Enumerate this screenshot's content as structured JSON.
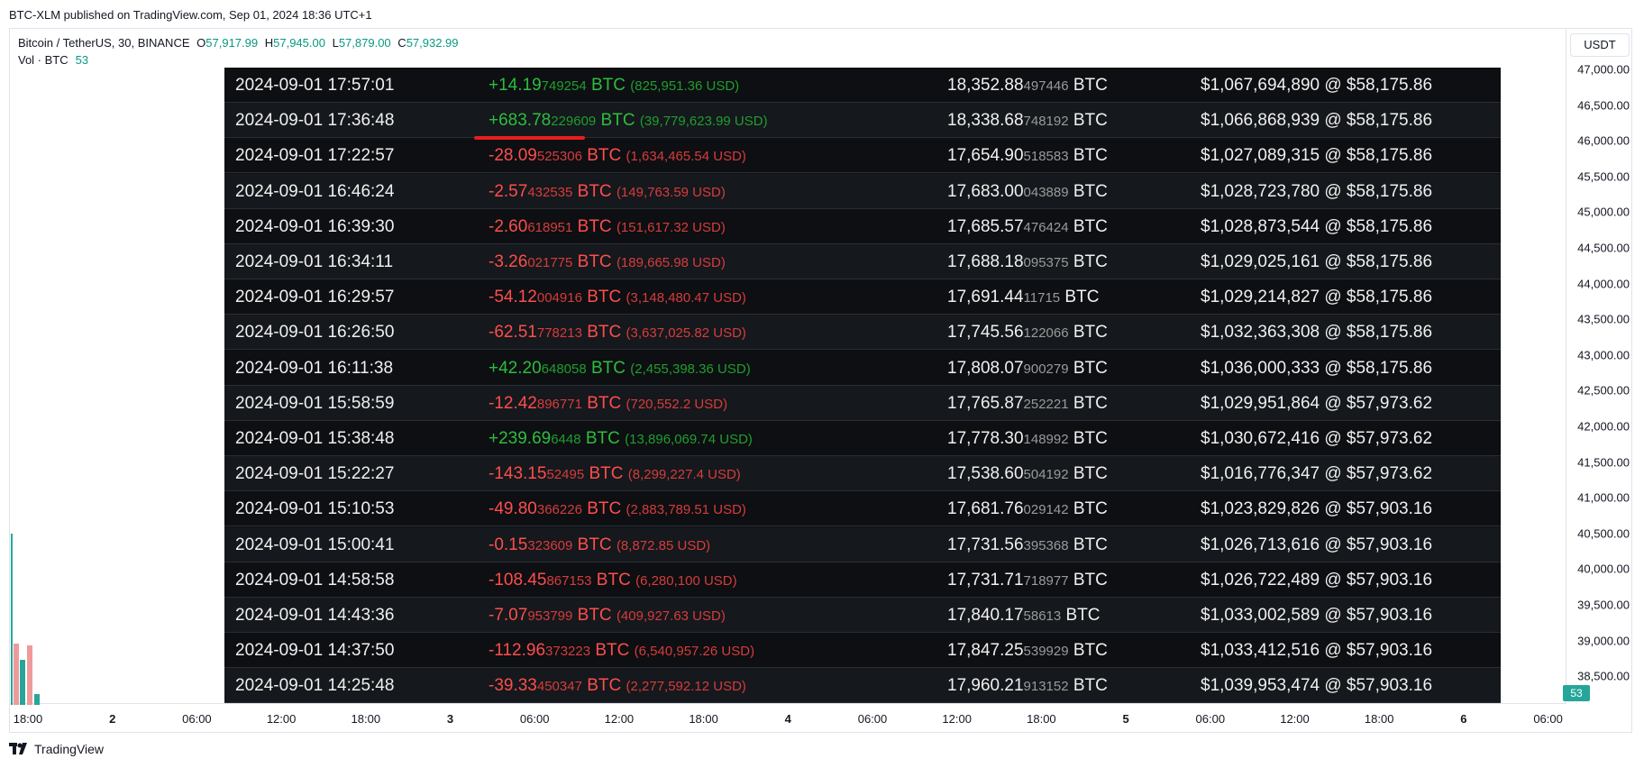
{
  "published": "BTC-XLM published on TradingView.com, Sep 01, 2024 18:36 UTC+1",
  "symbol": {
    "name": "Bitcoin / TetherUS, 30, BINANCE",
    "o_label": "O",
    "o": "57,917.99",
    "h_label": "H",
    "h": "57,945.00",
    "l_label": "L",
    "l": "57,879.00",
    "c_label": "C",
    "c": "57,932.99"
  },
  "volume": {
    "label": "Vol · BTC",
    "value": "53",
    "badge": "53"
  },
  "currency": "USDT",
  "price_axis": [
    "47,000.00",
    "46,500.00",
    "46,000.00",
    "45,500.00",
    "45,000.00",
    "44,500.00",
    "44,000.00",
    "43,500.00",
    "43,000.00",
    "42,500.00",
    "42,000.00",
    "41,500.00",
    "41,000.00",
    "40,500.00",
    "40,000.00",
    "39,500.00",
    "39,000.00",
    "38,500.00"
  ],
  "time_axis": [
    {
      "label": "18:00",
      "bold": false
    },
    {
      "label": "2",
      "bold": true
    },
    {
      "label": "06:00",
      "bold": false
    },
    {
      "label": "12:00",
      "bold": false
    },
    {
      "label": "18:00",
      "bold": false
    },
    {
      "label": "3",
      "bold": true
    },
    {
      "label": "06:00",
      "bold": false
    },
    {
      "label": "12:00",
      "bold": false
    },
    {
      "label": "18:00",
      "bold": false
    },
    {
      "label": "4",
      "bold": true
    },
    {
      "label": "06:00",
      "bold": false
    },
    {
      "label": "12:00",
      "bold": false
    },
    {
      "label": "18:00",
      "bold": false
    },
    {
      "label": "5",
      "bold": true
    },
    {
      "label": "06:00",
      "bold": false
    },
    {
      "label": "12:00",
      "bold": false
    },
    {
      "label": "18:00",
      "bold": false
    },
    {
      "label": "6",
      "bold": true
    },
    {
      "label": "06:00",
      "bold": false
    }
  ],
  "footer": {
    "brand": "TradingView"
  },
  "colors": {
    "up": "#26a69a",
    "down": "#ef9a9a",
    "positive": "#2ebd3d",
    "negative": "#ff4d4d"
  },
  "transactions": [
    {
      "time": "2024-09-01 17:57:01",
      "sign": "pos",
      "amt_main": "+14.19",
      "amt_small": "749254",
      "unit": "BTC",
      "usd": "(825,951.36 USD)",
      "bal_main": "18,352.88",
      "bal_small": "497446",
      "bal_unit": "BTC",
      "value": "$1,067,694,890 @ $58,175.86"
    },
    {
      "time": "2024-09-01 17:36:48",
      "sign": "pos",
      "amt_main": "+683.78",
      "amt_small": "229609",
      "unit": "BTC",
      "usd": "(39,779,623.99 USD)",
      "bal_main": "18,338.68",
      "bal_small": "748192",
      "bal_unit": "BTC",
      "value": "$1,066,868,939 @ $58,175.86"
    },
    {
      "time": "2024-09-01 17:22:57",
      "sign": "neg",
      "amt_main": "-28.09",
      "amt_small": "525306",
      "unit": "BTC",
      "usd": "(1,634,465.54 USD)",
      "bal_main": "17,654.90",
      "bal_small": "518583",
      "bal_unit": "BTC",
      "value": "$1,027,089,315 @ $58,175.86"
    },
    {
      "time": "2024-09-01 16:46:24",
      "sign": "neg",
      "amt_main": "-2.57",
      "amt_small": "432535",
      "unit": "BTC",
      "usd": "(149,763.59 USD)",
      "bal_main": "17,683.00",
      "bal_small": "043889",
      "bal_unit": "BTC",
      "value": "$1,028,723,780 @ $58,175.86"
    },
    {
      "time": "2024-09-01 16:39:30",
      "sign": "neg",
      "amt_main": "-2.60",
      "amt_small": "618951",
      "unit": "BTC",
      "usd": "(151,617.32 USD)",
      "bal_main": "17,685.57",
      "bal_small": "476424",
      "bal_unit": "BTC",
      "value": "$1,028,873,544 @ $58,175.86"
    },
    {
      "time": "2024-09-01 16:34:11",
      "sign": "neg",
      "amt_main": "-3.26",
      "amt_small": "021775",
      "unit": "BTC",
      "usd": "(189,665.98 USD)",
      "bal_main": "17,688.18",
      "bal_small": "095375",
      "bal_unit": "BTC",
      "value": "$1,029,025,161 @ $58,175.86"
    },
    {
      "time": "2024-09-01 16:29:57",
      "sign": "neg",
      "amt_main": "-54.12",
      "amt_small": "004916",
      "unit": "BTC",
      "usd": "(3,148,480.47 USD)",
      "bal_main": "17,691.44",
      "bal_small": "11715",
      "bal_unit": "BTC",
      "value": "$1,029,214,827 @ $58,175.86"
    },
    {
      "time": "2024-09-01 16:26:50",
      "sign": "neg",
      "amt_main": "-62.51",
      "amt_small": "778213",
      "unit": "BTC",
      "usd": "(3,637,025.82 USD)",
      "bal_main": "17,745.56",
      "bal_small": "122066",
      "bal_unit": "BTC",
      "value": "$1,032,363,308 @ $58,175.86"
    },
    {
      "time": "2024-09-01 16:11:38",
      "sign": "pos",
      "amt_main": "+42.20",
      "amt_small": "648058",
      "unit": "BTC",
      "usd": "(2,455,398.36 USD)",
      "bal_main": "17,808.07",
      "bal_small": "900279",
      "bal_unit": "BTC",
      "value": "$1,036,000,333 @ $58,175.86"
    },
    {
      "time": "2024-09-01 15:58:59",
      "sign": "neg",
      "amt_main": "-12.42",
      "amt_small": "896771",
      "unit": "BTC",
      "usd": "(720,552.2 USD)",
      "bal_main": "17,765.87",
      "bal_small": "252221",
      "bal_unit": "BTC",
      "value": "$1,029,951,864 @ $57,973.62"
    },
    {
      "time": "2024-09-01 15:38:48",
      "sign": "pos",
      "amt_main": "+239.69",
      "amt_small": "6448",
      "unit": "BTC",
      "usd": "(13,896,069.74 USD)",
      "bal_main": "17,778.30",
      "bal_small": "148992",
      "bal_unit": "BTC",
      "value": "$1,030,672,416 @ $57,973.62"
    },
    {
      "time": "2024-09-01 15:22:27",
      "sign": "neg",
      "amt_main": "-143.15",
      "amt_small": "52495",
      "unit": "BTC",
      "usd": "(8,299,227.4 USD)",
      "bal_main": "17,538.60",
      "bal_small": "504192",
      "bal_unit": "BTC",
      "value": "$1,016,776,347 @ $57,973.62"
    },
    {
      "time": "2024-09-01 15:10:53",
      "sign": "neg",
      "amt_main": "-49.80",
      "amt_small": "366226",
      "unit": "BTC",
      "usd": "(2,883,789.51 USD)",
      "bal_main": "17,681.76",
      "bal_small": "029142",
      "bal_unit": "BTC",
      "value": "$1,023,829,826 @ $57,903.16"
    },
    {
      "time": "2024-09-01 15:00:41",
      "sign": "neg",
      "amt_main": "-0.15",
      "amt_small": "323609",
      "unit": "BTC",
      "usd": "(8,872.85 USD)",
      "bal_main": "17,731.56",
      "bal_small": "395368",
      "bal_unit": "BTC",
      "value": "$1,026,713,616 @ $57,903.16"
    },
    {
      "time": "2024-09-01 14:58:58",
      "sign": "neg",
      "amt_main": "-108.45",
      "amt_small": "867153",
      "unit": "BTC",
      "usd": "(6,280,100 USD)",
      "bal_main": "17,731.71",
      "bal_small": "718977",
      "bal_unit": "BTC",
      "value": "$1,026,722,489 @ $57,903.16"
    },
    {
      "time": "2024-09-01 14:43:36",
      "sign": "neg",
      "amt_main": "-7.07",
      "amt_small": "953799",
      "unit": "BTC",
      "usd": "(409,927.63 USD)",
      "bal_main": "17,840.17",
      "bal_small": "58613",
      "bal_unit": "BTC",
      "value": "$1,033,002,589 @ $57,903.16"
    },
    {
      "time": "2024-09-01 14:37:50",
      "sign": "neg",
      "amt_main": "-112.96",
      "amt_small": "373223",
      "unit": "BTC",
      "usd": "(6,540,957.26 USD)",
      "bal_main": "17,847.25",
      "bal_small": "539929",
      "bal_unit": "BTC",
      "value": "$1,033,412,516 @ $57,903.16"
    },
    {
      "time": "2024-09-01 14:25:48",
      "sign": "neg",
      "amt_main": "-39.33",
      "amt_small": "450347",
      "unit": "BTC",
      "usd": "(2,277,592.12 USD)",
      "bal_main": "17,960.21",
      "bal_small": "913152",
      "bal_unit": "BTC",
      "value": "$1,039,953,474 @ $57,903.16"
    }
  ]
}
